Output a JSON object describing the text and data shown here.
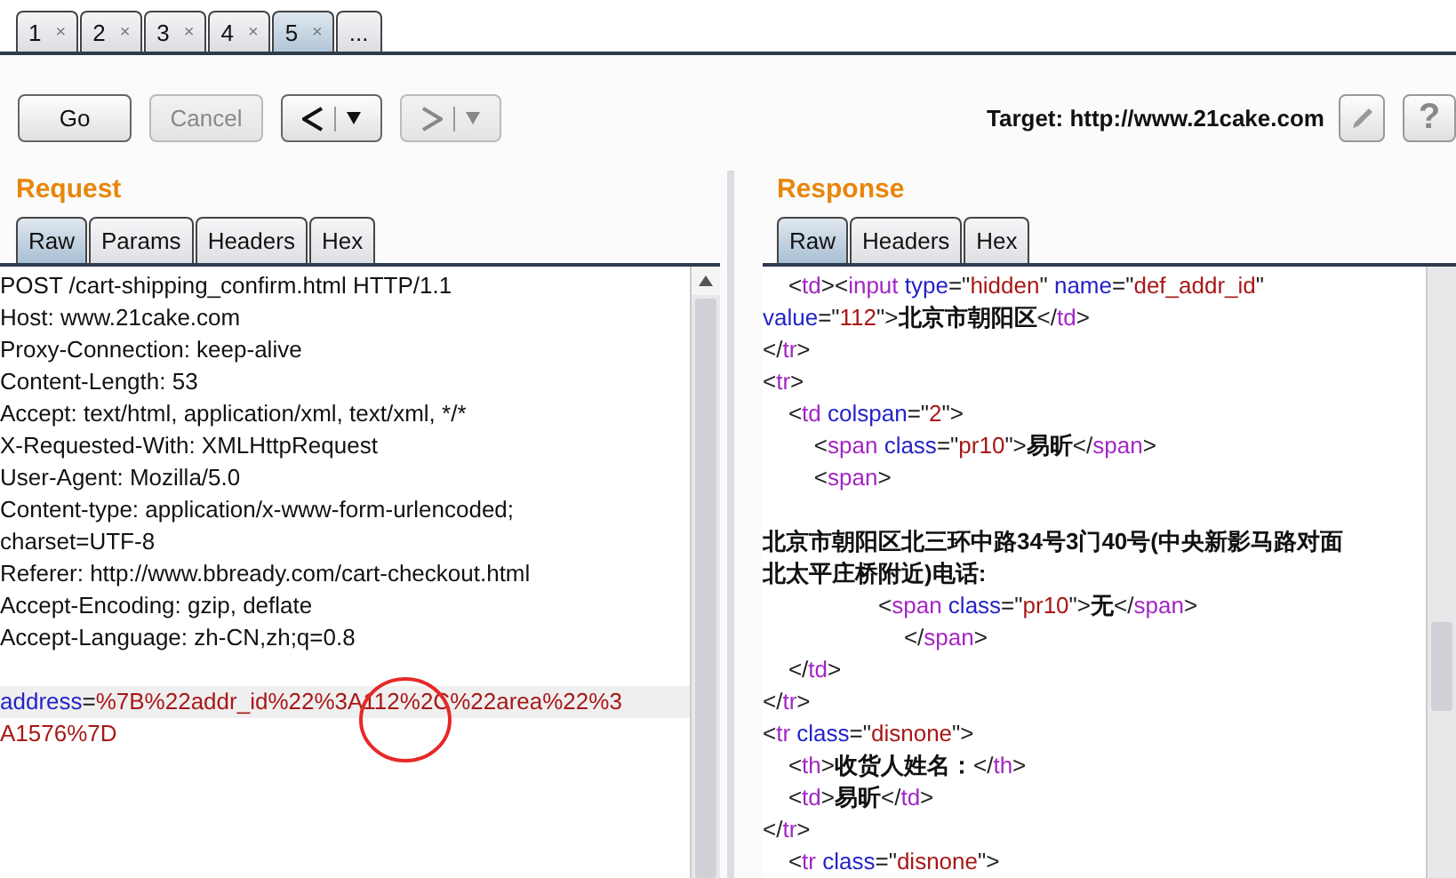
{
  "tabs": [
    {
      "label": "1",
      "close": "×",
      "selected": false
    },
    {
      "label": "2",
      "close": "×",
      "selected": false
    },
    {
      "label": "3",
      "close": "×",
      "selected": false
    },
    {
      "label": "4",
      "close": "×",
      "selected": false
    },
    {
      "label": "5",
      "close": "×",
      "selected": true
    }
  ],
  "more_tab": "...",
  "toolbar": {
    "buttons": [
      {
        "kind": "text",
        "label": "Go",
        "disabled": false
      },
      {
        "kind": "text",
        "label": "Cancel",
        "disabled": true
      },
      {
        "kind": "back",
        "disabled": false
      },
      {
        "kind": "forward",
        "disabled": true
      }
    ],
    "target": "Target: http://www.21cake.com",
    "help": "?"
  },
  "request": {
    "title": "Request",
    "tabs": [
      {
        "label": "Raw",
        "selected": true
      },
      {
        "label": "Params",
        "selected": false
      },
      {
        "label": "Headers",
        "selected": false
      },
      {
        "label": "Hex",
        "selected": false
      }
    ],
    "lines": [
      {
        "kind": "code",
        "highlighted": false,
        "tokens": [
          {
            "kind": "plain",
            "text": "POST /cart-shipping_confirm.html HTTP/1.1"
          }
        ]
      },
      {
        "kind": "code",
        "highlighted": false,
        "tokens": [
          {
            "kind": "plain",
            "text": "Host: www.21cake.com"
          }
        ]
      },
      {
        "kind": "code",
        "highlighted": false,
        "tokens": [
          {
            "kind": "plain",
            "text": "Proxy-Connection: keep-alive"
          }
        ]
      },
      {
        "kind": "code",
        "highlighted": false,
        "tokens": [
          {
            "kind": "plain",
            "text": "Content-Length: 53"
          }
        ]
      },
      {
        "kind": "code",
        "highlighted": false,
        "tokens": [
          {
            "kind": "plain",
            "text": "Accept: text/html, application/xml, text/xml, */*"
          }
        ]
      },
      {
        "kind": "code",
        "highlighted": false,
        "tokens": [
          {
            "kind": "plain",
            "text": "X-Requested-With: XMLHttpRequest"
          }
        ]
      },
      {
        "kind": "code",
        "highlighted": false,
        "tokens": [
          {
            "kind": "plain",
            "text": "User-Agent: Mozilla/5.0"
          }
        ]
      },
      {
        "kind": "code",
        "highlighted": false,
        "tokens": [
          {
            "kind": "plain",
            "text": "Content-type: application/x-www-form-urlencoded;"
          }
        ]
      },
      {
        "kind": "code",
        "highlighted": false,
        "tokens": [
          {
            "kind": "plain",
            "text": "charset=UTF-8"
          }
        ]
      },
      {
        "kind": "code",
        "highlighted": false,
        "tokens": [
          {
            "kind": "plain",
            "text": "Referer: http://www.bbready.com/cart-checkout.html"
          }
        ]
      },
      {
        "kind": "code",
        "highlighted": false,
        "tokens": [
          {
            "kind": "plain",
            "text": "Accept-Encoding: gzip, deflate"
          }
        ]
      },
      {
        "kind": "code",
        "highlighted": false,
        "tokens": [
          {
            "kind": "plain",
            "text": "Accept-Language: zh-CN,zh;q=0.8"
          }
        ]
      },
      {
        "kind": "blank",
        "highlighted": false
      },
      {
        "kind": "code",
        "highlighted": true,
        "tokens": [
          {
            "kind": "attr",
            "text": "address"
          },
          {
            "kind": "punct",
            "text": "="
          },
          {
            "kind": "value",
            "text": "%7B%22addr_id%22%3A112%2C%22area%22%3"
          }
        ]
      },
      {
        "kind": "code",
        "highlighted": false,
        "tokens": [
          {
            "kind": "value",
            "text": "A1576%7D"
          }
        ]
      }
    ]
  },
  "response": {
    "title": "Response",
    "tabs": [
      {
        "label": "Raw",
        "selected": true
      },
      {
        "label": "Headers",
        "selected": false
      },
      {
        "label": "Hex",
        "selected": false
      }
    ],
    "lines": [
      {
        "kind": "code",
        "tokens": [
          {
            "kind": "punct",
            "text": "    <"
          },
          {
            "kind": "tag",
            "text": "td"
          },
          {
            "kind": "punct",
            "text": "><"
          },
          {
            "kind": "tag",
            "text": "input"
          },
          {
            "kind": "attr",
            "text": " type"
          },
          {
            "kind": "punct",
            "text": "=\""
          },
          {
            "kind": "value",
            "text": "hidden"
          },
          {
            "kind": "punct",
            "text": "\""
          },
          {
            "kind": "attr",
            "text": " name"
          },
          {
            "kind": "punct",
            "text": "=\""
          },
          {
            "kind": "value",
            "text": "def_addr_id"
          },
          {
            "kind": "punct",
            "text": "\""
          }
        ]
      },
      {
        "kind": "code",
        "tokens": [
          {
            "kind": "attr",
            "text": "value"
          },
          {
            "kind": "punct",
            "text": "=\""
          },
          {
            "kind": "value",
            "text": "112"
          },
          {
            "kind": "punct",
            "text": "\">"
          },
          {
            "kind": "text",
            "text": "北京市朝阳区"
          },
          {
            "kind": "punct",
            "text": "</"
          },
          {
            "kind": "tag",
            "text": "td"
          },
          {
            "kind": "punct",
            "text": ">"
          }
        ]
      },
      {
        "kind": "code",
        "tokens": [
          {
            "kind": "punct",
            "text": "</"
          },
          {
            "kind": "tag",
            "text": "tr"
          },
          {
            "kind": "punct",
            "text": ">"
          }
        ]
      },
      {
        "kind": "code",
        "tokens": [
          {
            "kind": "punct",
            "text": "<"
          },
          {
            "kind": "tag",
            "text": "tr"
          },
          {
            "kind": "punct",
            "text": ">"
          }
        ]
      },
      {
        "kind": "code",
        "tokens": [
          {
            "kind": "punct",
            "text": "    <"
          },
          {
            "kind": "tag",
            "text": "td"
          },
          {
            "kind": "attr",
            "text": " colspan"
          },
          {
            "kind": "punct",
            "text": "=\""
          },
          {
            "kind": "value",
            "text": "2"
          },
          {
            "kind": "punct",
            "text": "\">"
          }
        ]
      },
      {
        "kind": "code",
        "tokens": [
          {
            "kind": "punct",
            "text": "        <"
          },
          {
            "kind": "tag",
            "text": "span"
          },
          {
            "kind": "attr",
            "text": " class"
          },
          {
            "kind": "punct",
            "text": "=\""
          },
          {
            "kind": "value",
            "text": "pr10"
          },
          {
            "kind": "punct",
            "text": "\">"
          },
          {
            "kind": "text",
            "text": "易昕"
          },
          {
            "kind": "punct",
            "text": "</"
          },
          {
            "kind": "tag",
            "text": "span"
          },
          {
            "kind": "punct",
            "text": ">"
          }
        ]
      },
      {
        "kind": "code",
        "tokens": [
          {
            "kind": "punct",
            "text": "        <"
          },
          {
            "kind": "tag",
            "text": "span"
          },
          {
            "kind": "punct",
            "text": ">"
          }
        ]
      },
      {
        "kind": "blank"
      },
      {
        "kind": "code",
        "tokens": [
          {
            "kind": "text",
            "text": "北京市朝阳区北三环中路34号3门40号(中央新影马路对面"
          }
        ]
      },
      {
        "kind": "code",
        "tokens": [
          {
            "kind": "text",
            "text": "北太平庄桥附近)电话:"
          }
        ]
      },
      {
        "kind": "code",
        "tokens": [
          {
            "kind": "punct",
            "text": "                  <"
          },
          {
            "kind": "tag",
            "text": "span"
          },
          {
            "kind": "attr",
            "text": " class"
          },
          {
            "kind": "punct",
            "text": "=\""
          },
          {
            "kind": "value",
            "text": "pr10"
          },
          {
            "kind": "punct",
            "text": "\">"
          },
          {
            "kind": "text",
            "text": "无"
          },
          {
            "kind": "punct",
            "text": "</"
          },
          {
            "kind": "tag",
            "text": "span"
          },
          {
            "kind": "punct",
            "text": ">"
          }
        ]
      },
      {
        "kind": "code",
        "tokens": [
          {
            "kind": "punct",
            "text": "                      </"
          },
          {
            "kind": "tag",
            "text": "span"
          },
          {
            "kind": "punct",
            "text": ">"
          }
        ]
      },
      {
        "kind": "code",
        "tokens": [
          {
            "kind": "punct",
            "text": "    </"
          },
          {
            "kind": "tag",
            "text": "td"
          },
          {
            "kind": "punct",
            "text": ">"
          }
        ]
      },
      {
        "kind": "code",
        "tokens": [
          {
            "kind": "punct",
            "text": "</"
          },
          {
            "kind": "tag",
            "text": "tr"
          },
          {
            "kind": "punct",
            "text": ">"
          }
        ]
      },
      {
        "kind": "code",
        "tokens": [
          {
            "kind": "punct",
            "text": "<"
          },
          {
            "kind": "tag",
            "text": "tr"
          },
          {
            "kind": "attr",
            "text": " class"
          },
          {
            "kind": "punct",
            "text": "=\""
          },
          {
            "kind": "value",
            "text": "disnone"
          },
          {
            "kind": "punct",
            "text": "\">"
          }
        ]
      },
      {
        "kind": "code",
        "tokens": [
          {
            "kind": "punct",
            "text": "    <"
          },
          {
            "kind": "tag",
            "text": "th"
          },
          {
            "kind": "punct",
            "text": ">"
          },
          {
            "kind": "text",
            "text": "收货人姓名："
          },
          {
            "kind": "punct",
            "text": "</"
          },
          {
            "kind": "tag",
            "text": "th"
          },
          {
            "kind": "punct",
            "text": ">"
          }
        ]
      },
      {
        "kind": "code",
        "tokens": [
          {
            "kind": "punct",
            "text": "    <"
          },
          {
            "kind": "tag",
            "text": "td"
          },
          {
            "kind": "punct",
            "text": ">"
          },
          {
            "kind": "text",
            "text": "易昕"
          },
          {
            "kind": "punct",
            "text": "</"
          },
          {
            "kind": "tag",
            "text": "td"
          },
          {
            "kind": "punct",
            "text": ">"
          }
        ]
      },
      {
        "kind": "code",
        "tokens": [
          {
            "kind": "punct",
            "text": "</"
          },
          {
            "kind": "tag",
            "text": "tr"
          },
          {
            "kind": "punct",
            "text": ">"
          }
        ]
      },
      {
        "kind": "code",
        "tokens": [
          {
            "kind": "punct",
            "text": "    <"
          },
          {
            "kind": "tag",
            "text": "tr"
          },
          {
            "kind": "attr",
            "text": " class"
          },
          {
            "kind": "punct",
            "text": "=\""
          },
          {
            "kind": "value",
            "text": "disnone"
          },
          {
            "kind": "punct",
            "text": "\">"
          }
        ]
      }
    ]
  }
}
